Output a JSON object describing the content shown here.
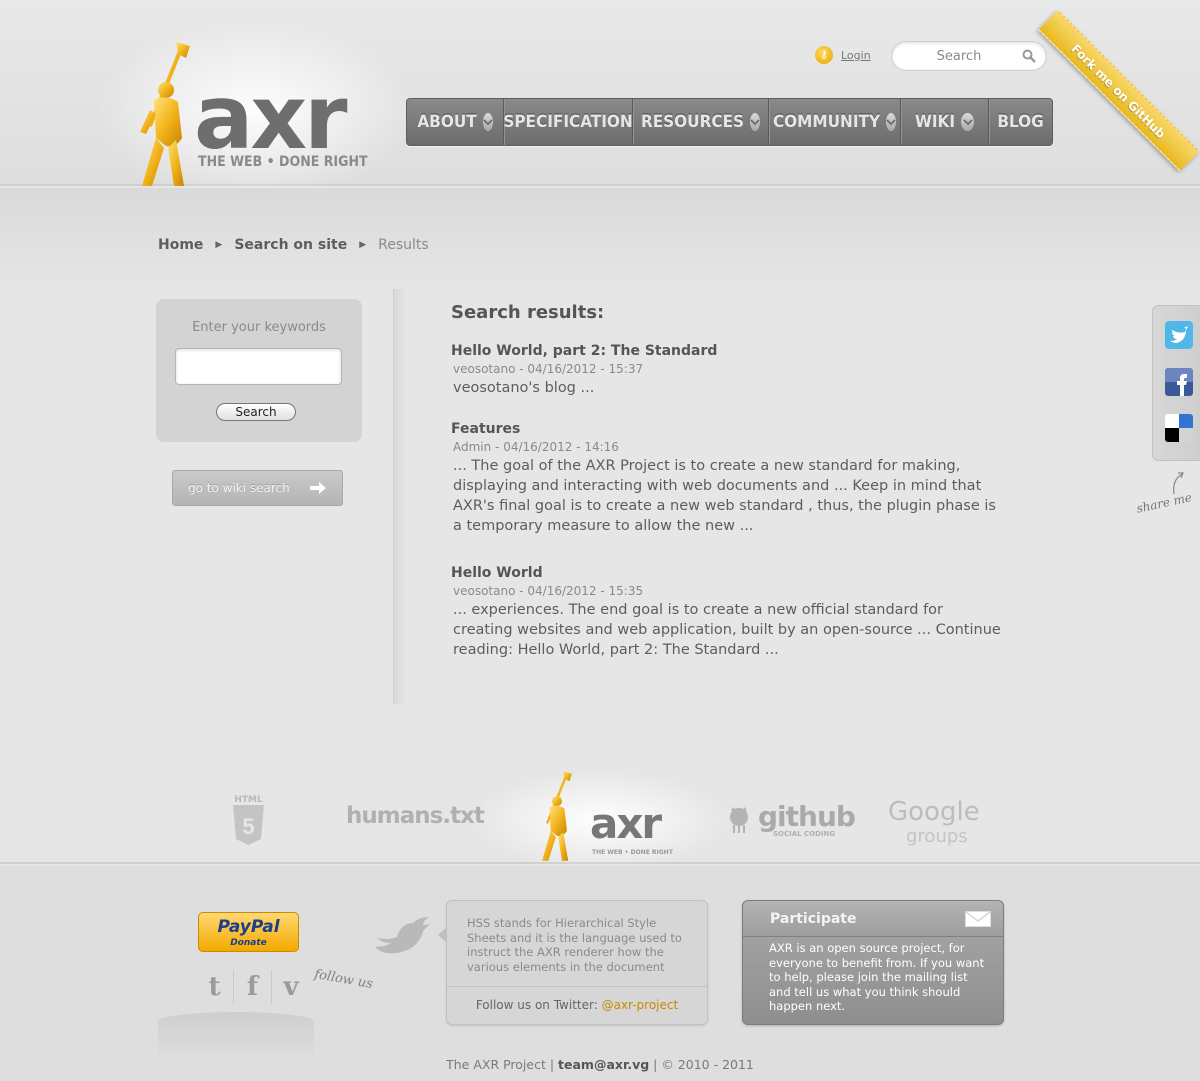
{
  "brand": {
    "logo_text": "axr",
    "tagline": "THE WEB  •  DONE RIGHT",
    "accent_color": "#e8b01a"
  },
  "header": {
    "login_label": "Login",
    "search_placeholder": "Search",
    "fork_ribbon": "Fork me on GitHub"
  },
  "nav": {
    "items": [
      {
        "label": "ABOUT",
        "has_dropdown": true
      },
      {
        "label": "SPECIFICATION",
        "has_dropdown": false
      },
      {
        "label": "RESOURCES",
        "has_dropdown": true
      },
      {
        "label": "COMMUNITY",
        "has_dropdown": true
      },
      {
        "label": "WIKI",
        "has_dropdown": true
      },
      {
        "label": "BLOG",
        "has_dropdown": false
      }
    ]
  },
  "breadcrumb": {
    "home": "Home",
    "search": "Search on site",
    "current": "Results"
  },
  "sidebar": {
    "label": "Enter your keywords",
    "input_value": "",
    "search_button": "Search",
    "wiki_button": "go to wiki search"
  },
  "results": {
    "title": "Search results:",
    "items": [
      {
        "title": "Hello World, part 2: The Standard",
        "meta": "veosotano - 04/16/2012 - 15:37",
        "snippet": "veosotano's blog ..."
      },
      {
        "title": "Features",
        "meta": "Admin - 04/16/2012 - 14:16",
        "snippet": "... The goal of the AXR Project is to create a new standard for making, displaying and interacting with web documents and ... Keep in mind that AXR's final goal is to create a new web standard , thus, the plugin phase is a temporary measure to allow the new ..."
      },
      {
        "title": "Hello World",
        "meta": "veosotano - 04/16/2012 - 15:35",
        "snippet": "... experiences. The end goal is to create a new official standard for creating websites and web application, built by an open-source ...   Continue reading: Hello World, part 2: The Standard ..."
      }
    ]
  },
  "share": {
    "icons": [
      "twitter-icon",
      "facebook-icon",
      "delicious-icon"
    ],
    "note": "share me"
  },
  "partners": {
    "html5": "HTML",
    "humans": "humans.txt",
    "github": "github",
    "github_sub": "SOCIAL CODING",
    "google": "Google",
    "google_sub": "groups"
  },
  "footer": {
    "paypal": "PayPal",
    "paypal_sub": "Donate",
    "follow_note": "follow us",
    "tweet": "HSS stands for Hierarchical Style Sheets and it is the language used to instruct the AXR renderer how the various elements in the document",
    "follow_prefix": "Follow us on Twitter: ",
    "twitter_handle": "@axr-project",
    "participate_title": "Participate",
    "participate_body": "AXR is an open source project, for everyone to benefit from. If you want to help, please join the mailing list and tell us what you think should happen next.",
    "copyright_prefix": "The AXR Project | ",
    "copyright_email": "team@axr.vg",
    "copyright_suffix": " | © 2010 - 2011"
  }
}
